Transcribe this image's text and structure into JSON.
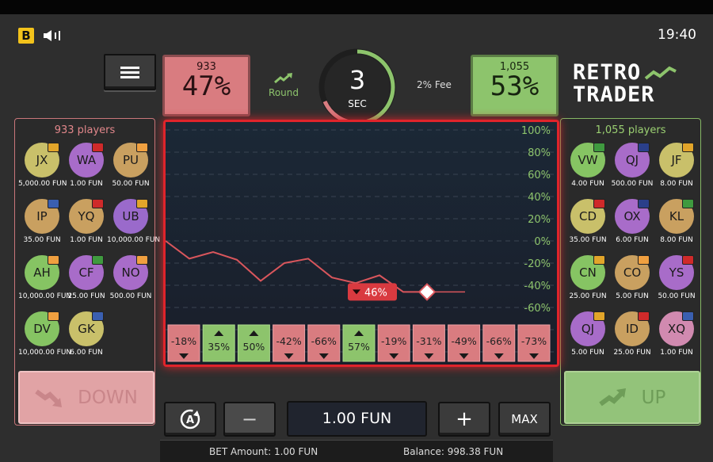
{
  "top_bar": {
    "brand_badge": "B",
    "time": "19:40"
  },
  "stats": {
    "down": {
      "count": "933",
      "percent": "47%"
    },
    "up": {
      "count": "1,055",
      "percent": "53%"
    },
    "round_label": "Round",
    "fee_label": "2% Fee",
    "timer": {
      "value": "3",
      "unit": "SEC"
    }
  },
  "brand": {
    "line1": "RETRO",
    "line2": "TRADER"
  },
  "left_panel": {
    "title": "933 players",
    "players": [
      {
        "initials": "JX",
        "bet": "5,000.00 FUN",
        "color": "#c9c06a",
        "flag": "#e2a52a"
      },
      {
        "initials": "WA",
        "bet": "1.00 FUN",
        "color": "#a86cc9",
        "flag": "#cf2a2a"
      },
      {
        "initials": "PU",
        "bet": "50.00 FUN",
        "color": "#c9a060",
        "flag": "#f0a040"
      },
      {
        "initials": "IP",
        "bet": "35.00 FUN",
        "color": "#c9a060",
        "flag": "#3a5fb0"
      },
      {
        "initials": "YQ",
        "bet": "1.00 FUN",
        "color": "#c9a060",
        "flag": "#cf2a2a"
      },
      {
        "initials": "UB",
        "bet": "10,000.00 FUN",
        "color": "#9a6acb",
        "flag": "#e2a52a"
      },
      {
        "initials": "AH",
        "bet": "10,000.00 FUN",
        "color": "#86c463",
        "flag": "#f0a040"
      },
      {
        "initials": "CF",
        "bet": "25.00 FUN",
        "color": "#a86cc9",
        "flag": "#3f9a3f"
      },
      {
        "initials": "NO",
        "bet": "500.00 FUN",
        "color": "#a86cc9",
        "flag": "#f0a040"
      },
      {
        "initials": "DV",
        "bet": "10,000.00 FUN",
        "color": "#86c463",
        "flag": "#f0a040"
      },
      {
        "initials": "GK",
        "bet": "6.00 FUN",
        "color": "#c9c06a",
        "flag": "#3a5fb0"
      }
    ]
  },
  "right_panel": {
    "title": "1,055 players",
    "players": [
      {
        "initials": "VW",
        "bet": "4.00 FUN",
        "color": "#86c463",
        "flag": "#3f9a3f"
      },
      {
        "initials": "QJ",
        "bet": "500.00 FUN",
        "color": "#a86cc9",
        "flag": "#2a3f8a"
      },
      {
        "initials": "JF",
        "bet": "8.00 FUN",
        "color": "#c9c06a",
        "flag": "#e2a52a"
      },
      {
        "initials": "CD",
        "bet": "35.00 FUN",
        "color": "#c9c06a",
        "flag": "#cf2a2a"
      },
      {
        "initials": "OX",
        "bet": "6.00 FUN",
        "color": "#a86cc9",
        "flag": "#2a3f8a"
      },
      {
        "initials": "KL",
        "bet": "8.00 FUN",
        "color": "#c9a060",
        "flag": "#3f9a3f"
      },
      {
        "initials": "CN",
        "bet": "25.00 FUN",
        "color": "#86c463",
        "flag": "#e2a52a"
      },
      {
        "initials": "CO",
        "bet": "5.00 FUN",
        "color": "#c9a060",
        "flag": "#f0a040"
      },
      {
        "initials": "YS",
        "bet": "50.00 FUN",
        "color": "#a86cc9",
        "flag": "#cf2a2a"
      },
      {
        "initials": "QJ",
        "bet": "5.00 FUN",
        "color": "#a86cc9",
        "flag": "#e2a52a"
      },
      {
        "initials": "ID",
        "bet": "25.00 FUN",
        "color": "#c9a060",
        "flag": "#cf2a2a"
      },
      {
        "initials": "XQ",
        "bet": "1.00 FUN",
        "color": "#d18ab0",
        "flag": "#3a5fb0"
      }
    ]
  },
  "buttons": {
    "down": "DOWN",
    "up": "UP",
    "max": "MAX",
    "minus": "−",
    "plus": "+"
  },
  "bet_input": {
    "value": "1.00 FUN"
  },
  "footer": {
    "bet_amount": "BET Amount: 1.00 FUN",
    "balance": "Balance: 998.38 FUN"
  },
  "colors": {
    "down": "#d97c80",
    "up": "#8dc46c",
    "chart_border": "#e0242b",
    "line": "#d9565c"
  },
  "chart_data": {
    "type": "line",
    "y_ticks": [
      "100%",
      "80%",
      "60%",
      "40%",
      "20%",
      "0%",
      "-20%",
      "-40%",
      "-60%",
      "-80%",
      "-100%"
    ],
    "ylim": [
      -100,
      100
    ],
    "x": [
      0,
      1,
      2,
      3,
      4,
      5,
      6,
      7,
      8,
      9,
      10,
      11
    ],
    "values": [
      0,
      -16,
      -10,
      -17,
      -36,
      -20,
      -16,
      -33,
      -38,
      -31,
      -46,
      -46
    ],
    "current_label": "46%",
    "history": [
      {
        "label": "-18%",
        "direction": "down"
      },
      {
        "label": "35%",
        "direction": "up"
      },
      {
        "label": "50%",
        "direction": "up"
      },
      {
        "label": "-42%",
        "direction": "down"
      },
      {
        "label": "-66%",
        "direction": "down"
      },
      {
        "label": "57%",
        "direction": "up"
      },
      {
        "label": "-19%",
        "direction": "down"
      },
      {
        "label": "-31%",
        "direction": "down"
      },
      {
        "label": "-49%",
        "direction": "down"
      },
      {
        "label": "-66%",
        "direction": "down"
      },
      {
        "label": "-73%",
        "direction": "down"
      }
    ]
  }
}
